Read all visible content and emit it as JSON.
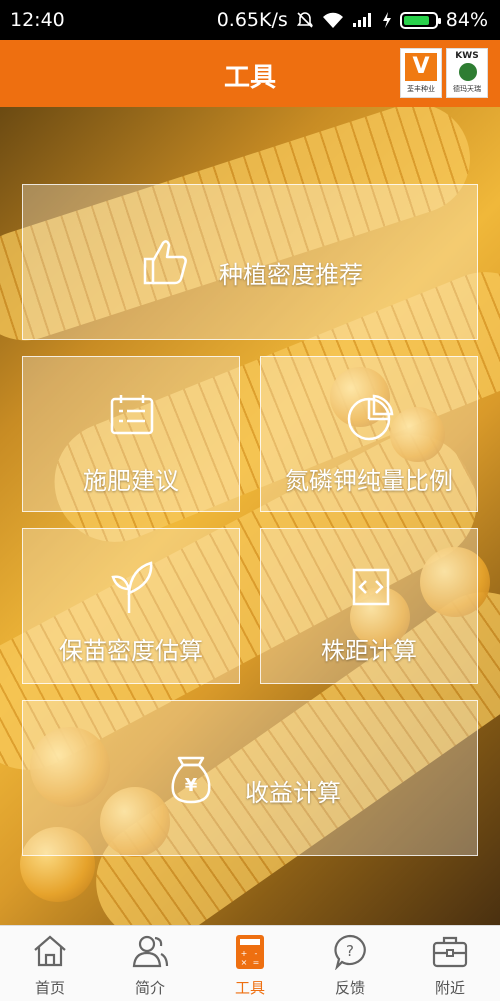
{
  "status": {
    "time": "12:40",
    "speed": "0.65K/s",
    "battery": "84%",
    "battery_level": 0.84,
    "battery_color": "#29d14a"
  },
  "header": {
    "title": "工具",
    "logo1_caption": "荃丰种业",
    "logo2_top": "KWS",
    "logo2_caption": "德玛天瑞",
    "accent": "#ee6f10"
  },
  "tiles": {
    "planting": "种植密度推荐",
    "fertilizer": "施肥建议",
    "npk": "氮磷钾纯量比例",
    "seedling": "保苗密度估算",
    "spacing": "株距计算",
    "profit": "收益计算"
  },
  "icons": {
    "planting": "thumbs-up-icon",
    "fertilizer": "calendar-list-icon",
    "npk": "pie-chart-icon",
    "seedling": "sprout-icon",
    "spacing": "arrows-box-icon",
    "profit": "money-bag-icon"
  },
  "nav": [
    {
      "label": "首页",
      "icon": "home-icon"
    },
    {
      "label": "简介",
      "icon": "people-icon"
    },
    {
      "label": "工具",
      "icon": "calculator-icon",
      "active": true
    },
    {
      "label": "反馈",
      "icon": "question-bubble-icon"
    },
    {
      "label": "附近",
      "icon": "briefcase-icon"
    }
  ]
}
